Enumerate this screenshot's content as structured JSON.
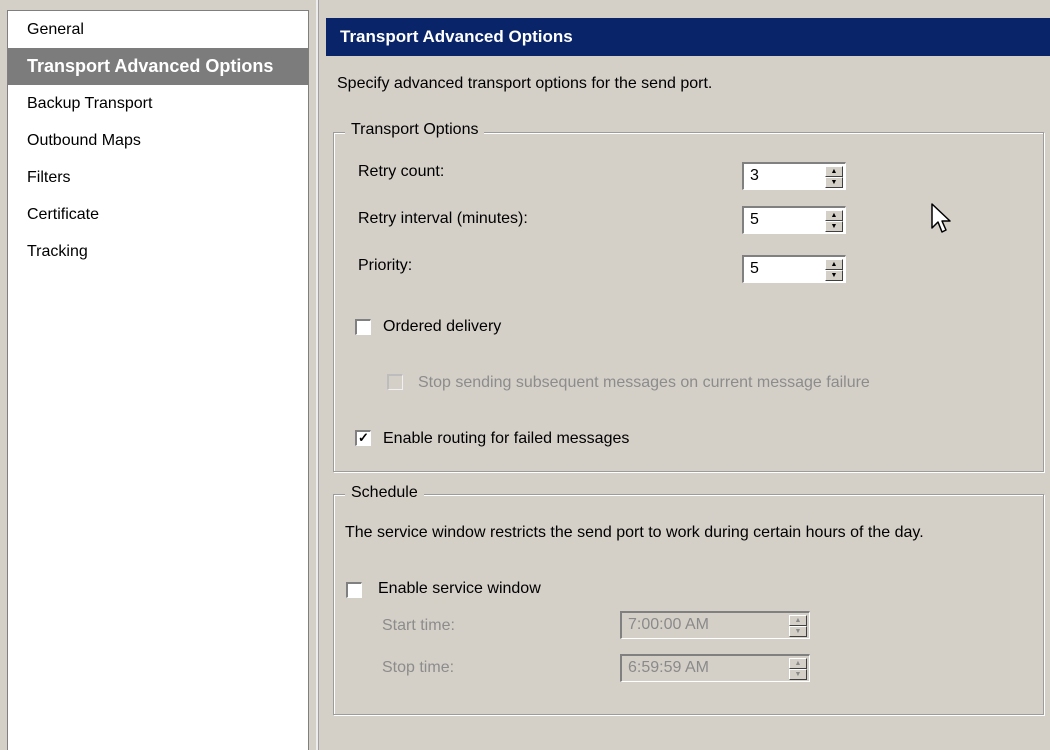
{
  "sidebar": {
    "items": [
      {
        "label": "General"
      },
      {
        "label": "Transport Advanced Options",
        "selected": true
      },
      {
        "label": "Backup Transport"
      },
      {
        "label": "Outbound Maps"
      },
      {
        "label": "Filters"
      },
      {
        "label": "Certificate"
      },
      {
        "label": "Tracking"
      }
    ]
  },
  "panel": {
    "title": "Transport Advanced Options",
    "description": "Specify advanced transport options for the send port."
  },
  "transport_options": {
    "legend": "Transport Options",
    "retry_count_label": "Retry count:",
    "retry_count_value": "3",
    "retry_interval_label": "Retry interval (minutes):",
    "retry_interval_value": "5",
    "priority_label": "Priority:",
    "priority_value": "5",
    "ordered_delivery_label": "Ordered delivery",
    "ordered_delivery_checked": false,
    "stop_sending_label": "Stop sending subsequent messages on current message failure",
    "stop_sending_checked": false,
    "enable_routing_label": "Enable routing for failed messages",
    "enable_routing_checked": true
  },
  "schedule": {
    "legend": "Schedule",
    "description": "The service window restricts the send port to work during certain hours of the day.",
    "enable_window_label": "Enable service window",
    "enable_window_checked": false,
    "start_time_label": "Start time:",
    "start_time_value": "7:00:00 AM",
    "stop_time_label": "Stop time:",
    "stop_time_value": "6:59:59 AM"
  },
  "icons": {
    "spin_up": "up-arrow-icon",
    "spin_down": "down-arrow-icon",
    "check": "checkmark-icon",
    "cursor": "mouse-pointer-icon"
  },
  "colors": {
    "header_bg": "#0a246a",
    "selected_bg": "#7c7c7c",
    "dialog_bg": "#d4d0c8"
  }
}
